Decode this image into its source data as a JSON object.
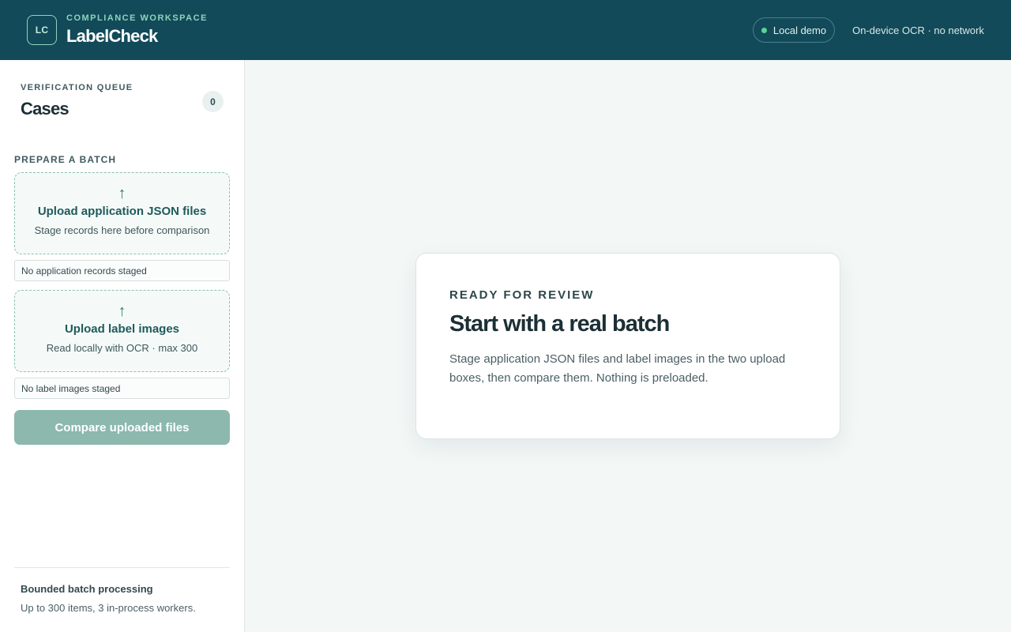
{
  "header": {
    "logo_initials": "LC",
    "eyebrow": "COMPLIANCE WORKSPACE",
    "app_name": "LabelCheck",
    "mode_pill": "Local demo",
    "ocr_note": "On-device OCR · no network",
    "status_color": "#59d49a"
  },
  "sidebar": {
    "queue_eyebrow": "VERIFICATION QUEUE",
    "queue_title": "Cases",
    "case_count": "0",
    "section_label": "PREPARE A BATCH",
    "json_upload": {
      "icon": "upload-arrow-icon",
      "title": "Upload application JSON files",
      "subtitle": "Stage records here before comparison",
      "staged_status": "No application records staged"
    },
    "image_upload": {
      "icon": "upload-arrow-icon",
      "title": "Upload label images",
      "subtitle": "Read locally with OCR · max 300",
      "staged_status": "No label images staged"
    },
    "compare_button": "Compare uploaded files",
    "footer": {
      "title": "Bounded batch processing",
      "subtitle": "Up to 300 items, 3 in-process workers."
    }
  },
  "main": {
    "card": {
      "eyebrow": "READY FOR REVIEW",
      "title": "Start with a real batch",
      "body": "Stage application JSON files and label images in the two upload boxes, then compare them. Nothing is preloaded."
    }
  },
  "colors": {
    "header_bg": "#124a59",
    "accent": "#2f7f68",
    "button_disabled": "#8cb8ae"
  }
}
